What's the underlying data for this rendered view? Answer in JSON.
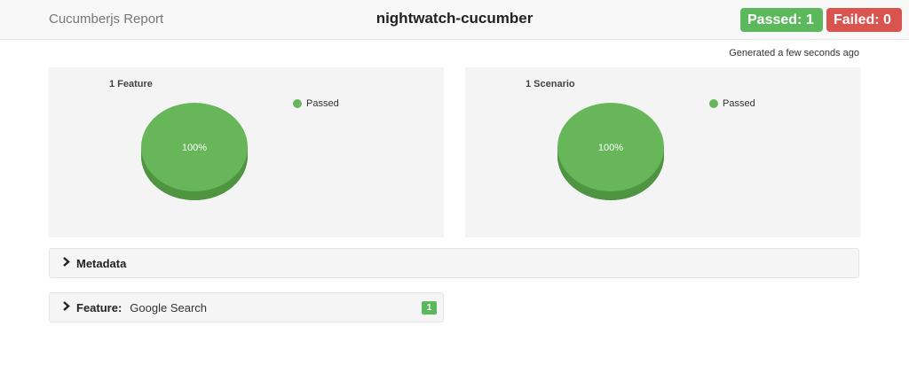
{
  "header": {
    "brand": "Cucumberjs Report",
    "project": "nightwatch-cucumber",
    "passed_label": "Passed: 1",
    "failed_label": "Failed: 0"
  },
  "generated": "Generated a few seconds ago",
  "colors": {
    "passed": "#5cb85c",
    "failed": "#d9534f",
    "pie_top": "#67b75a",
    "pie_side": "#4f9441"
  },
  "chart_data": [
    {
      "type": "pie",
      "title": "1 Feature",
      "slices": [
        {
          "name": "Passed",
          "value": 100,
          "label": "100%"
        }
      ],
      "legend": "top-right"
    },
    {
      "type": "pie",
      "title": "1 Scenario",
      "slices": [
        {
          "name": "Passed",
          "value": 100,
          "label": "100%"
        }
      ],
      "legend": "top-right"
    }
  ],
  "metadata": {
    "label": "Metadata"
  },
  "feature": {
    "prefix": "Feature:",
    "name": "Google Search",
    "count": "1"
  }
}
